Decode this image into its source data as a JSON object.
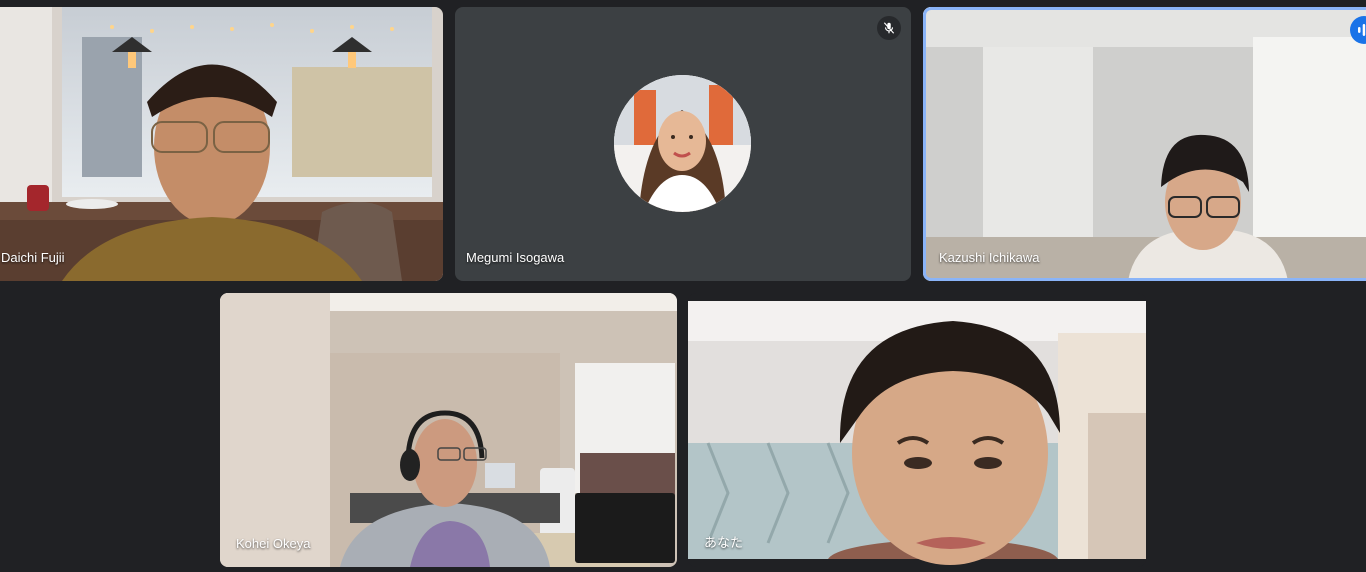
{
  "participants": [
    {
      "name": "Daichi Fujii"
    },
    {
      "name": "Megumi Isogawa",
      "muted": true
    },
    {
      "name": "Kazushi Ichikawa",
      "speaking": true
    },
    {
      "name": "Kohei Okeya"
    },
    {
      "name": "あなた"
    }
  ],
  "colors": {
    "background": "#202124",
    "tile": "#3c4043",
    "active_speaker_border": "#8ab4f8",
    "speaking_badge": "#1a73e8"
  },
  "icons": {
    "muted": "mic-off-icon",
    "speaking": "audio-wave-icon"
  }
}
